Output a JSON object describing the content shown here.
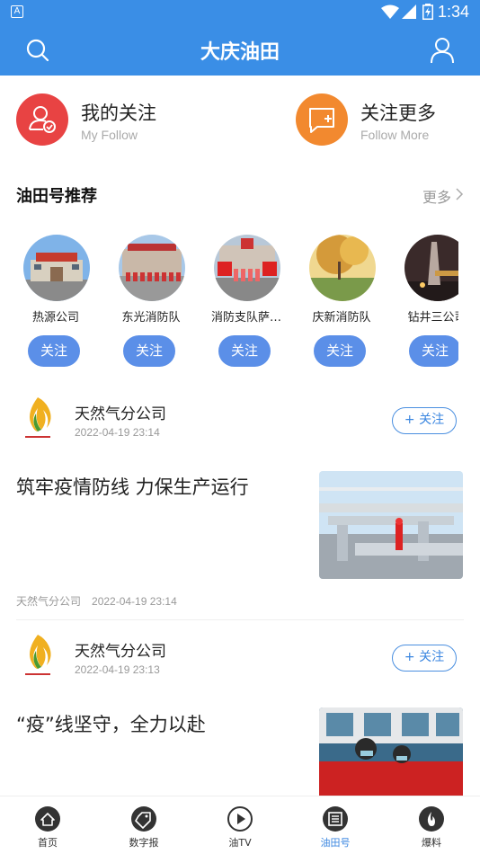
{
  "status_bar": {
    "app_badge": "A",
    "time": "1:34"
  },
  "header": {
    "title": "大庆油田"
  },
  "follow": {
    "my": {
      "label": "我的关注",
      "sub": "My Follow"
    },
    "more": {
      "label": "关注更多",
      "sub": "Follow  More"
    }
  },
  "section": {
    "title": "油田号推荐",
    "more": "更多"
  },
  "accounts": [
    {
      "name": "热源公司",
      "button": "关注"
    },
    {
      "name": "东光消防队",
      "button": "关注"
    },
    {
      "name": "消防支队萨…",
      "button": "关注"
    },
    {
      "name": "庆新消防队",
      "button": "关注"
    },
    {
      "name": "钻井三公司",
      "button": "关注"
    }
  ],
  "feed": [
    {
      "source": "天然气分公司",
      "date": "2022-04-19 23:14",
      "follow_button": "+ 关注",
      "headline": "筑牢疫情防线 力保生产运行",
      "meta_source": "天然气分公司",
      "meta_date": "2022-04-19 23:14"
    },
    {
      "source": "天然气分公司",
      "date": "2022-04-19 23:13",
      "follow_button": "+ 关注",
      "headline": "“疫”线坚守，全力以赴"
    }
  ],
  "nav": [
    {
      "label": "首页",
      "icon": "home-icon"
    },
    {
      "label": "数字报",
      "icon": "tag-icon"
    },
    {
      "label": "油TV",
      "icon": "play-icon"
    },
    {
      "label": "油田号",
      "icon": "news-icon",
      "active": true
    },
    {
      "label": "爆料",
      "icon": "fire-icon"
    }
  ],
  "colors": {
    "brand_blue": "#3a8ee6",
    "follow_red": "#e84343",
    "follow_orange": "#f2892f",
    "button_blue": "#5b8fe8",
    "active_nav": "#3a86e0"
  }
}
